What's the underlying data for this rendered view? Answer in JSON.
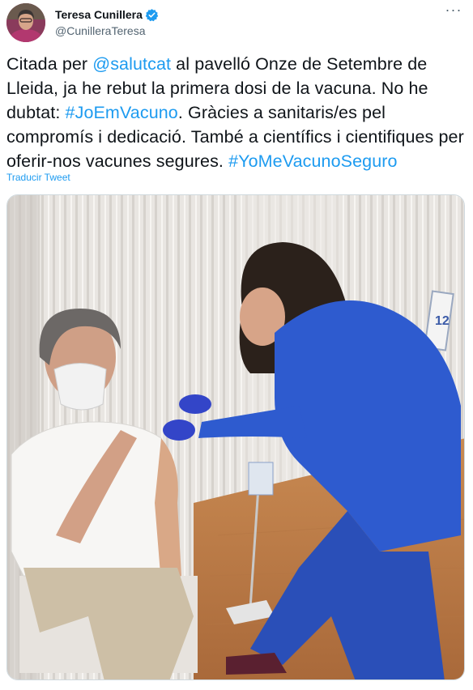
{
  "author": {
    "display_name": "Teresa Cunillera",
    "handle": "@CunilleraTeresa",
    "verified": true,
    "avatar_icon": "profile-photo"
  },
  "more_icon": "ellipsis-icon",
  "tweet": {
    "segments": [
      {
        "type": "text",
        "value": "Citada per "
      },
      {
        "type": "link",
        "value": "@salutcat"
      },
      {
        "type": "text",
        "value": " al pavelló Onze de Setembre de Lleida, ja he rebut la primera dosi de la vacuna. No he dubtat: "
      },
      {
        "type": "link",
        "value": "#JoEmVacuno"
      },
      {
        "type": "text",
        "value": ". Gràcies a sanitaris/es pel compromís i dedicació. També a científics i cientifiques per oferir-nos vacunes segures. "
      },
      {
        "type": "link",
        "value": "#YoMeVacunoSeguro"
      }
    ],
    "translate_label": "Traducir Tweet"
  },
  "media": {
    "type": "photo",
    "booth_number": "12"
  },
  "colors": {
    "link": "#1d9bf0",
    "verified": "#1d9bf0",
    "secondary_text": "#536471"
  }
}
